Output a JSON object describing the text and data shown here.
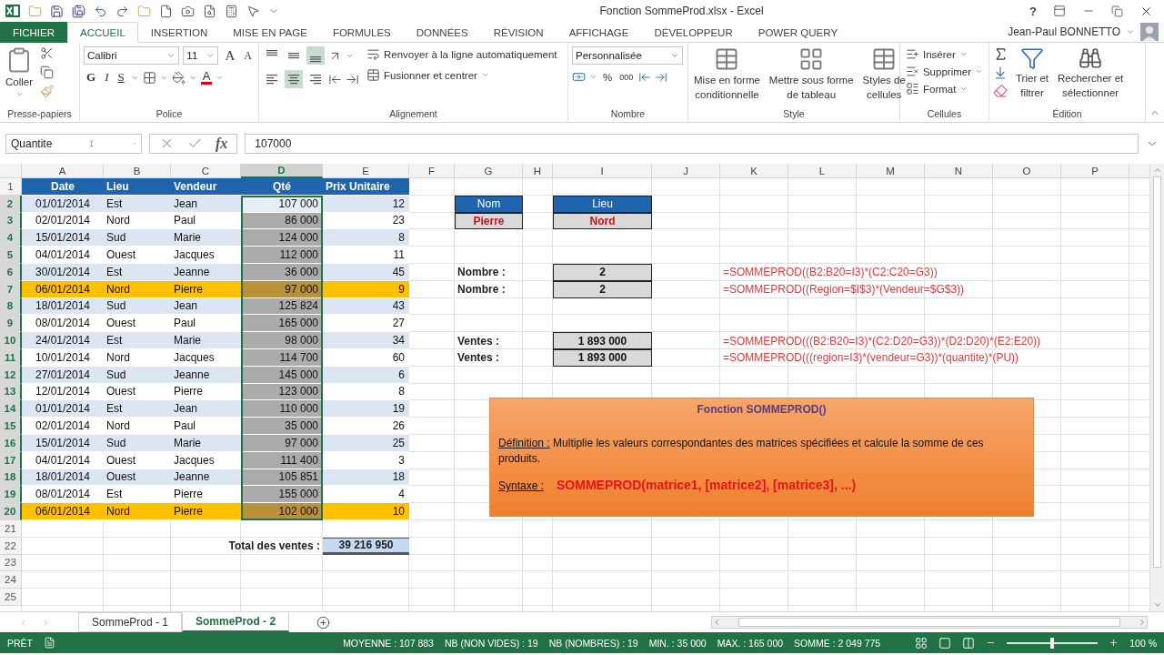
{
  "window": {
    "title": "Fonction SommeProd.xlsx - Excel",
    "help": "?"
  },
  "ribbon_tabs": [
    {
      "label": "FICHIER",
      "kind": "file",
      "selected": false
    },
    {
      "label": "ACCUEIL",
      "kind": "tab",
      "selected": true
    },
    {
      "label": "INSERTION",
      "kind": "tab",
      "selected": false
    },
    {
      "label": "MISE EN PAGE",
      "kind": "tab",
      "selected": false
    },
    {
      "label": "FORMULES",
      "kind": "tab",
      "selected": false
    },
    {
      "label": "DONNÉES",
      "kind": "tab",
      "selected": false
    },
    {
      "label": "RÉVISION",
      "kind": "tab",
      "selected": false
    },
    {
      "label": "AFFICHAGE",
      "kind": "tab",
      "selected": false
    },
    {
      "label": "DÉVELOPPEUR",
      "kind": "tab",
      "selected": false
    },
    {
      "label": "POWER QUERY",
      "kind": "tab",
      "selected": false
    }
  ],
  "user": {
    "name": "Jean-Paul BONNETTO"
  },
  "ribbon": {
    "clipboard": {
      "paste": "Coller",
      "label": "Presse-papiers"
    },
    "font": {
      "name": "Calibri",
      "size": "11",
      "grow": "A",
      "shrink": "A",
      "bold": "G",
      "italic": "I",
      "underline": "S",
      "font_color_label": "A",
      "label": "Police"
    },
    "alignment": {
      "vertical": [
        {
          "selected": false
        },
        {
          "selected": false
        },
        {
          "selected": true
        }
      ],
      "horizontal": [
        {
          "selected": false
        },
        {
          "selected": true
        },
        {
          "selected": false
        }
      ],
      "wrap": "Renvoyer à la ligne automatiquement",
      "merge": "Fusionner et centrer",
      "label": "Alignement"
    },
    "number": {
      "format": "Personnalisée",
      "percent": "%",
      "thousands": "000",
      "label": "Nombre"
    },
    "styles": {
      "buttons": [
        {
          "lines": [
            "Mise en forme",
            "conditionnelle"
          ]
        },
        {
          "lines": [
            "Mettre sous forme",
            "de tableau"
          ]
        },
        {
          "lines": [
            "Styles de",
            "cellules"
          ]
        }
      ],
      "label": "Style"
    },
    "cells": {
      "buttons": [
        "Insérer",
        "Supprimer",
        "Format"
      ],
      "label": "Cellules"
    },
    "editing": {
      "sort": [
        "Trier et",
        "filtrer"
      ],
      "find": [
        "Rechercher et",
        "sélectionner"
      ],
      "label": "Édition"
    }
  },
  "formula_bar": {
    "name_box": "Quantite",
    "fx": "fx",
    "value": "107000"
  },
  "columns": [
    {
      "label": "A",
      "selected": false
    },
    {
      "label": "B",
      "selected": false
    },
    {
      "label": "C",
      "selected": false
    },
    {
      "label": "D",
      "selected": true
    },
    {
      "label": "E",
      "selected": false
    },
    {
      "label": "F",
      "selected": false
    },
    {
      "label": "G",
      "selected": false
    },
    {
      "label": "H",
      "selected": false
    },
    {
      "label": "I",
      "selected": false
    },
    {
      "label": "J",
      "selected": false
    },
    {
      "label": "K",
      "selected": false
    },
    {
      "label": "L",
      "selected": false
    },
    {
      "label": "M",
      "selected": false
    },
    {
      "label": "N",
      "selected": false
    },
    {
      "label": "O",
      "selected": false
    },
    {
      "label": "P",
      "selected": false
    }
  ],
  "row_headers": [
    {
      "label": "1",
      "selected": false
    },
    {
      "label": "2",
      "selected": true
    },
    {
      "label": "3",
      "selected": true
    },
    {
      "label": "4",
      "selected": true
    },
    {
      "label": "5",
      "selected": true
    },
    {
      "label": "6",
      "selected": true
    },
    {
      "label": "7",
      "selected": true
    },
    {
      "label": "8",
      "selected": true
    },
    {
      "label": "9",
      "selected": true
    },
    {
      "label": "10",
      "selected": true
    },
    {
      "label": "11",
      "selected": true
    },
    {
      "label": "12",
      "selected": true
    },
    {
      "label": "13",
      "selected": true
    },
    {
      "label": "14",
      "selected": true
    },
    {
      "label": "15",
      "selected": true
    },
    {
      "label": "16",
      "selected": true
    },
    {
      "label": "17",
      "selected": true
    },
    {
      "label": "18",
      "selected": true
    },
    {
      "label": "19",
      "selected": true
    },
    {
      "label": "20",
      "selected": true
    },
    {
      "label": "21",
      "selected": false
    },
    {
      "label": "22",
      "selected": false
    },
    {
      "label": "23",
      "selected": false
    },
    {
      "label": "24",
      "selected": false
    },
    {
      "label": "25",
      "selected": false
    }
  ],
  "table": {
    "headers": [
      "Date",
      "Lieu",
      "Vendeur",
      "Qté",
      "Prix Unitaire"
    ],
    "rows": [
      {
        "cells": [
          "01/01/2014",
          "Est",
          "Jean",
          "107 000",
          "12"
        ],
        "highlighted": false,
        "active": true
      },
      {
        "cells": [
          "02/01/2014",
          "Nord",
          "Paul",
          "86 000",
          "23"
        ],
        "highlighted": false,
        "active": false
      },
      {
        "cells": [
          "15/01/2014",
          "Sud",
          "Marie",
          "124 000",
          "8"
        ],
        "highlighted": false,
        "active": false
      },
      {
        "cells": [
          "04/01/2014",
          "Ouest",
          "Jacques",
          "112 000",
          "11"
        ],
        "highlighted": false,
        "active": false
      },
      {
        "cells": [
          "30/01/2014",
          "Est",
          "Jeanne",
          "36 000",
          "45"
        ],
        "highlighted": false,
        "active": false
      },
      {
        "cells": [
          "06/01/2014",
          "Nord",
          "Pierre",
          "97 000",
          "9"
        ],
        "highlighted": true,
        "active": false
      },
      {
        "cells": [
          "18/01/2014",
          "Sud",
          "Jean",
          "125 824",
          "43"
        ],
        "highlighted": false,
        "active": false
      },
      {
        "cells": [
          "08/01/2014",
          "Ouest",
          "Paul",
          "165 000",
          "27"
        ],
        "highlighted": false,
        "active": false
      },
      {
        "cells": [
          "24/01/2014",
          "Est",
          "Marie",
          "98 000",
          "34"
        ],
        "highlighted": false,
        "active": false
      },
      {
        "cells": [
          "10/01/2014",
          "Nord",
          "Jacques",
          "114 700",
          "60"
        ],
        "highlighted": false,
        "active": false
      },
      {
        "cells": [
          "27/01/2014",
          "Sud",
          "Jeanne",
          "145 000",
          "6"
        ],
        "highlighted": false,
        "active": false
      },
      {
        "cells": [
          "12/01/2014",
          "Ouest",
          "Pierre",
          "123 000",
          "8"
        ],
        "highlighted": false,
        "active": false
      },
      {
        "cells": [
          "01/01/2014",
          "Est",
          "Jean",
          "110 000",
          "19"
        ],
        "highlighted": false,
        "active": false
      },
      {
        "cells": [
          "02/01/2014",
          "Nord",
          "Paul",
          "35 000",
          "26"
        ],
        "highlighted": false,
        "active": false
      },
      {
        "cells": [
          "15/01/2014",
          "Sud",
          "Marie",
          "97 000",
          "25"
        ],
        "highlighted": false,
        "active": false
      },
      {
        "cells": [
          "04/01/2014",
          "Ouest",
          "Jacques",
          "111 400",
          "3"
        ],
        "highlighted": false,
        "active": false
      },
      {
        "cells": [
          "18/01/2014",
          "Ouest",
          "Jeanne",
          "105 851",
          "18"
        ],
        "highlighted": false,
        "active": false
      },
      {
        "cells": [
          "08/01/2014",
          "Est",
          "Pierre",
          "155 000",
          "4"
        ],
        "highlighted": false,
        "active": false
      },
      {
        "cells": [
          "06/01/2014",
          "Nord",
          "Pierre",
          "102 000",
          "10"
        ],
        "highlighted": true,
        "active": false
      }
    ]
  },
  "total": {
    "label": "Total des ventes :",
    "value": "39 216 950"
  },
  "criteria": [
    {
      "header": "Nom",
      "value": "Pierre"
    },
    {
      "header": "Lieu",
      "value": "Nord"
    }
  ],
  "results": [
    {
      "label": "Nombre :",
      "value": "2",
      "formula": "=SOMMEPROD((B2:B20=I3)*(C2:C20=G3))"
    },
    {
      "label": "Nombre :",
      "value": "2",
      "formula": "=SOMMEPROD((Region=$I$3)*(Vendeur=$G$3))"
    },
    {
      "label": "Ventes :",
      "value": "1 893 000",
      "formula": "=SOMMEPROD(((B2:B20=I3)*(C2:D20=G3))*(D2:D20)*(E2:E20))"
    },
    {
      "label": "Ventes :",
      "value": "1 893 000",
      "formula": "=SOMMEPROD(((region=I3)*(vendeur=G3))*(quantite)*(PU))"
    }
  ],
  "info_box": {
    "title": "Fonction SOMMEPROD()",
    "definition_label": "Définition :",
    "definition": "Multiplie les valeurs correspondantes des matrices spécifiées et calcule la somme de ces produits.",
    "syntax_label": "Syntaxe :",
    "syntax": "SOMMEPROD(matrice1, [matrice2], [matrice3], ...)"
  },
  "sheet_tabs": [
    {
      "label": "SommeProd - 1",
      "selected": false
    },
    {
      "label": "SommeProd - 2",
      "selected": true
    }
  ],
  "status_bar": {
    "ready": "PRÊT",
    "stats": [
      "MOYENNE : 107 883",
      "NB (NON VIDES) : 19",
      "NB (NOMBRES) : 19",
      "MIN. : 35 000",
      "MAX. : 165 000",
      "SOMME : 2 049 775"
    ],
    "zoom_slider": {
      "level": 0.5
    },
    "zoom": "100 %"
  }
}
